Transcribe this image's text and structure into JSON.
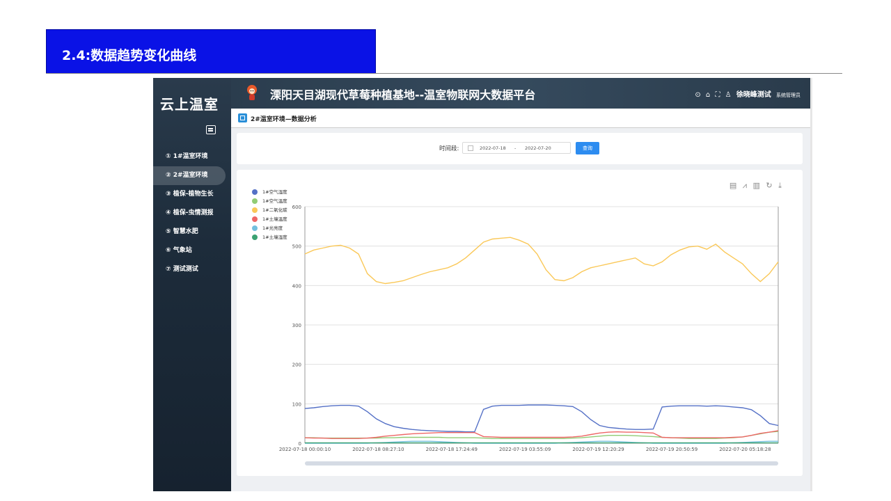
{
  "slide": {
    "title": "2.4:数据趋势变化曲线"
  },
  "sidebar": {
    "brand": "云上温室",
    "items": [
      {
        "label": "① 1#温室环境"
      },
      {
        "label": "② 2#温室环境",
        "active": true
      },
      {
        "label": "③ 植保-植物生长"
      },
      {
        "label": "④ 植保-虫情测报"
      },
      {
        "label": "⑤ 智慧水肥"
      },
      {
        "label": "⑥ 气象站"
      },
      {
        "label": "⑦ 测试测试"
      }
    ]
  },
  "header": {
    "title": "溧阳天目湖现代草莓种植基地--温室物联网大数据平台",
    "icons": [
      "back-icon",
      "home-icon",
      "fullscreen-icon",
      "user-icon"
    ],
    "user_name": "徐晓峰测试",
    "user_role": "系统管理员"
  },
  "page": {
    "title": "2#温室环境—数据分析"
  },
  "filter": {
    "label": "时间段:",
    "start_date": "2022-07-18",
    "separator": "-",
    "end_date": "2022-07-20",
    "query_label": "查询"
  },
  "toolbox": {
    "icons": [
      "data-view-icon",
      "line-chart-icon",
      "bar-chart-icon",
      "restore-icon",
      "download-icon"
    ]
  },
  "chart_data": {
    "type": "line",
    "title": "",
    "xlabel": "",
    "ylabel": "",
    "ylim": [
      0,
      600
    ],
    "yticks": [
      0,
      100,
      200,
      300,
      400,
      500,
      600
    ],
    "x_tick_labels": [
      "2022-07-18 00:00:10",
      "2022-07-18 08:27:10",
      "2022-07-18 17:24:49",
      "2022-07-19 03:55:09",
      "2022-07-19 12:20:29",
      "2022-07-19 20:50:59",
      "2022-07-20 05:18:28"
    ],
    "grid": true,
    "legend_position": "top-left",
    "series": [
      {
        "name": "1#空气湿度",
        "color": "#5470c6",
        "values": [
          88,
          90,
          93,
          95,
          96,
          96,
          94,
          80,
          62,
          50,
          42,
          38,
          35,
          33,
          32,
          31,
          30,
          30,
          29,
          29,
          86,
          94,
          96,
          96,
          96,
          97,
          97,
          97,
          96,
          95,
          93,
          80,
          60,
          45,
          40,
          38,
          36,
          35,
          35,
          36,
          92,
          94,
          95,
          95,
          95,
          94,
          95,
          94,
          92,
          90,
          85,
          70,
          50,
          45
        ]
      },
      {
        "name": "1#空气温度",
        "color": "#91cc75",
        "values": [
          14,
          14,
          13,
          13,
          13,
          13,
          13,
          13,
          13,
          14,
          14,
          15,
          15,
          15,
          15,
          15,
          14,
          14,
          14,
          14,
          13,
          12,
          12,
          12,
          12,
          12,
          12,
          12,
          12,
          12,
          13,
          14,
          16,
          18,
          20,
          20,
          20,
          19,
          18,
          17,
          15,
          14,
          13,
          12,
          12,
          12,
          12,
          13,
          14,
          16,
          20,
          24,
          28,
          30
        ]
      },
      {
        "name": "1#二氧化碳",
        "color": "#fac858",
        "values": [
          480,
          490,
          495,
          500,
          502,
          495,
          480,
          430,
          410,
          405,
          408,
          412,
          420,
          428,
          435,
          440,
          445,
          455,
          470,
          490,
          510,
          518,
          520,
          522,
          515,
          505,
          480,
          440,
          415,
          412,
          420,
          435,
          445,
          450,
          455,
          460,
          465,
          470,
          455,
          450,
          460,
          478,
          490,
          498,
          500,
          492,
          505,
          485,
          470,
          455,
          430,
          410,
          430,
          460
        ]
      },
      {
        "name": "1#土壤温度",
        "color": "#ee6666",
        "values": [
          14,
          13,
          13,
          12,
          12,
          12,
          12,
          13,
          15,
          18,
          20,
          22,
          24,
          25,
          26,
          27,
          27,
          27,
          27,
          27,
          17,
          16,
          15,
          15,
          15,
          15,
          15,
          15,
          15,
          15,
          16,
          18,
          22,
          26,
          28,
          29,
          28,
          28,
          27,
          26,
          15,
          14,
          14,
          14,
          14,
          14,
          14,
          14,
          15,
          16,
          20,
          25,
          28,
          32
        ]
      },
      {
        "name": "1#光亮度",
        "color": "#73c0de",
        "values": [
          0,
          0,
          0,
          0,
          0,
          0,
          0,
          0,
          1,
          2,
          3,
          4,
          5,
          5,
          5,
          4,
          3,
          2,
          1,
          0,
          0,
          0,
          0,
          0,
          0,
          0,
          0,
          0,
          0,
          1,
          2,
          3,
          4,
          5,
          5,
          4,
          3,
          2,
          1,
          0,
          0,
          0,
          0,
          0,
          0,
          0,
          0,
          0,
          1,
          2,
          3,
          4,
          5,
          5
        ]
      },
      {
        "name": "1#土壤湿度",
        "color": "#3ba272",
        "values": [
          1,
          1,
          1,
          1,
          1,
          1,
          1,
          1,
          1,
          1,
          1,
          1,
          1,
          1,
          1,
          1,
          1,
          1,
          1,
          1,
          1,
          1,
          1,
          1,
          1,
          1,
          1,
          1,
          1,
          1,
          1,
          1,
          1,
          1,
          1,
          1,
          1,
          1,
          1,
          1,
          1,
          1,
          1,
          1,
          1,
          1,
          1,
          1,
          1,
          1,
          1,
          1,
          1,
          1
        ]
      }
    ]
  }
}
